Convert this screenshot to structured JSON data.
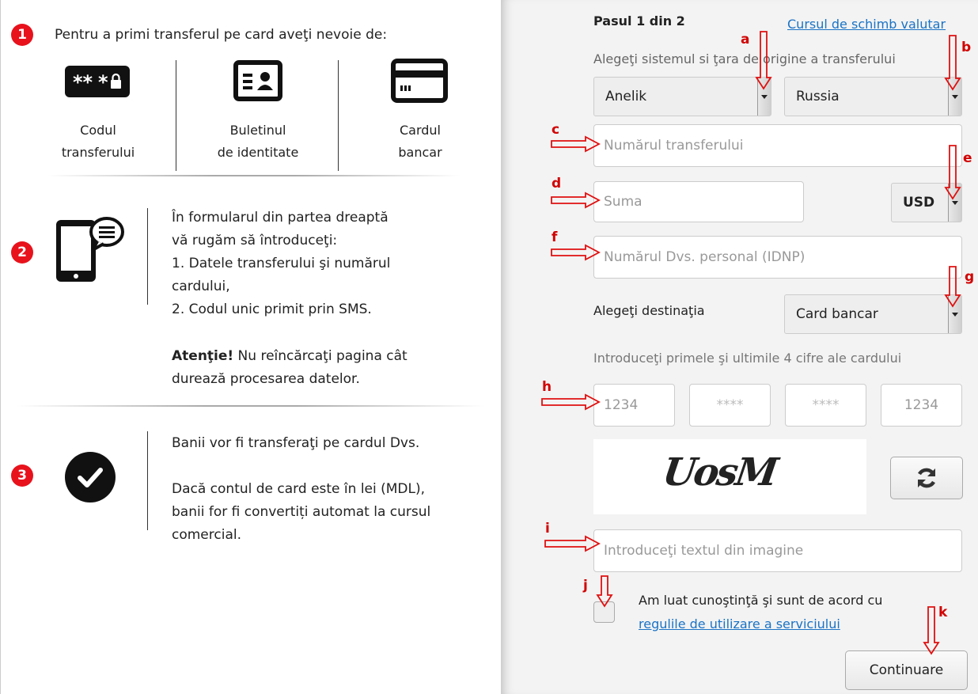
{
  "left": {
    "step1": {
      "number": "1",
      "title": "Pentru a primi transferul pe card aveţi nevoie de:",
      "items": [
        {
          "icon": "password-icon",
          "line1": "Codul",
          "line2": "transferului"
        },
        {
          "icon": "id-card-icon",
          "line1": "Buletinul",
          "line2": "de identitate"
        },
        {
          "icon": "bank-card-icon",
          "line1": "Cardul",
          "line2": "bancar"
        }
      ]
    },
    "step2": {
      "number": "2",
      "lines": [
        "În formularul din partea dreaptă",
        "vă rugăm să întroduceţi:",
        "1.  Datele transferului şi numărul",
        "cardului,",
        "2.  Codul unic primit prin SMS."
      ],
      "warning_bold": "Atenţie!",
      "warning_rest": " Nu reîncărcaţi pagina cât",
      "warning_line2": "durează procesarea datelor."
    },
    "step3": {
      "number": "3",
      "line1": "Banii vor fi transferaţi pe cardul Dvs.",
      "lines": [
        "Dacă contul de card este în lei (MDL),",
        "banii for fi convertiți automat la cursul",
        "comercial."
      ]
    }
  },
  "form": {
    "step_label": "Pasul 1 din 2",
    "exchange_link": "Cursul de schimb valutar",
    "system_prompt": "Alegeţi sistemul si ţara de origine a transferului",
    "system_value": "Anelik",
    "country_value": "Russia",
    "transfer_number_placeholder": "Numărul transferului",
    "amount_placeholder": "Suma",
    "currency_value": "USD",
    "idnp_placeholder": "Numărul Dvs. personal (IDNP)",
    "destination_label": "Alegeţi destinaţia",
    "destination_value": "Card bancar",
    "card_prompt": "Introduceţi primele şi ultimile 4 cifre ale cardului",
    "card_fields": [
      "1234",
      "****",
      "****",
      "1234"
    ],
    "captcha_text": "UosM",
    "captcha_input_placeholder": "Introduceţi textul din imagine",
    "agree_text": "Am luat cunoştinţă şi sunt de acord cu",
    "agree_link": "regulile de utilizare a serviciului",
    "continue_label": "Continuare"
  },
  "annotations": {
    "a": "a",
    "b": "b",
    "c": "c",
    "d": "d",
    "e": "e",
    "f": "f",
    "g": "g",
    "h": "h",
    "i": "i",
    "j": "j",
    "k": "k"
  },
  "colors": {
    "accent_red": "#e8121c",
    "link_blue": "#1a73c6",
    "annotation_red": "#d10000"
  }
}
